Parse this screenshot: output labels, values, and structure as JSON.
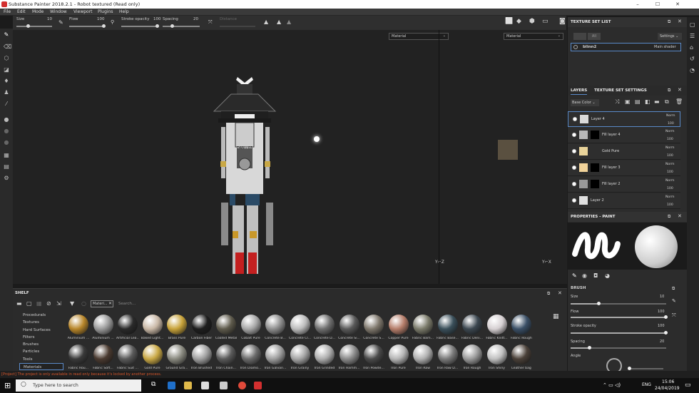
{
  "window": {
    "title": "Substance Painter 2018.2.1 - Robot textured (Read only)",
    "controls": [
      "–",
      "☐",
      "✕"
    ]
  },
  "menu": [
    "File",
    "Edit",
    "Mode",
    "Window",
    "Viewport",
    "Plugins",
    "Help"
  ],
  "toolbar": {
    "size_label": "Size",
    "size_value": "10",
    "flow_label": "Flow",
    "flow_value": "100",
    "stroke_label": "Stroke opacity",
    "stroke_value": "100",
    "spacing_label": "Spacing",
    "spacing_value": "20",
    "distance_label": "Distance"
  },
  "viewport": {
    "left_select": "Material",
    "right_select": "Material",
    "robot_label": "DAN - 03"
  },
  "shelf": {
    "title": "SHELF",
    "categories": [
      "Procedurals",
      "Textures",
      "Hard Surfaces",
      "Filters",
      "Brushes",
      "Particles",
      "Tools",
      "Materials"
    ],
    "selected_category": "Materials",
    "filter_tag": "Materi...",
    "search_placeholder": "Search...",
    "row1": [
      {
        "name": "Aluminium ...",
        "color": "#b8862a"
      },
      {
        "name": "Aluminium ...",
        "color": "#9a9a9a"
      },
      {
        "name": "Artificial Lea...",
        "color": "#2a2a2a"
      },
      {
        "name": "Baked Light...",
        "color": "#c9b8a6"
      },
      {
        "name": "Brass Pure",
        "color": "#c8a33a"
      },
      {
        "name": "Carbon Fiber",
        "color": "#1e1e1e"
      },
      {
        "name": "Coated Metal",
        "color": "#5e5a4c"
      },
      {
        "name": "Cobalt Pure",
        "color": "#a8a8a8"
      },
      {
        "name": "Concrete B...",
        "color": "#8e8e8e"
      },
      {
        "name": "Concrete Cl...",
        "color": "#bcbcbc"
      },
      {
        "name": "Concrete D...",
        "color": "#6e6e6e"
      },
      {
        "name": "Concrete Si...",
        "color": "#595959"
      },
      {
        "name": "Concrete S...",
        "color": "#7e776c"
      },
      {
        "name": "Copper Pure",
        "color": "#b57d6a"
      },
      {
        "name": "Fabric Bam...",
        "color": "#7a7a6a"
      },
      {
        "name": "Fabric Base...",
        "color": "#3a4f5a"
      },
      {
        "name": "Fabric Deni...",
        "color": "#3c4750"
      },
      {
        "name": "Fabric Knitt...",
        "color": "#d6d0d2"
      },
      {
        "name": "Fabric Rough",
        "color": "#3a4f66"
      }
    ],
    "row2": [
      {
        "name": "Fabric Rou...",
        "color": "#3a3a3a"
      },
      {
        "name": "Fabric Soft...",
        "color": "#4a3a30"
      },
      {
        "name": "Fabric Suit ...",
        "color": "#5a5a5a"
      },
      {
        "name": "Gold Pure",
        "color": "#c9a845"
      },
      {
        "name": "Ground Gra...",
        "color": "#8a8a80"
      },
      {
        "name": "Iron Brushed",
        "color": "#a0a0a0"
      },
      {
        "name": "Iron Chain...",
        "color": "#5a5a5a"
      },
      {
        "name": "Iron Diamo...",
        "color": "#6a6a6a"
      },
      {
        "name": "Iron Galvan...",
        "color": "#9e9e9e"
      },
      {
        "name": "Iron Grainy",
        "color": "#a5a5a5"
      },
      {
        "name": "Iron Grinded",
        "color": "#adadad"
      },
      {
        "name": "Iron Hamm...",
        "color": "#8a8a8a"
      },
      {
        "name": "Iron Powde...",
        "color": "#4a4a4a"
      },
      {
        "name": "Iron Pure",
        "color": "#b5b5b5"
      },
      {
        "name": "Iron Raw",
        "color": "#b0b0b0"
      },
      {
        "name": "Iron Raw D...",
        "color": "#7a7a7a"
      },
      {
        "name": "Iron Rough",
        "color": "#9a9a9a"
      },
      {
        "name": "Iron Shiny",
        "color": "#c0c0c0"
      },
      {
        "name": "Leather bag",
        "color": "#4a4038"
      }
    ]
  },
  "texture_set_list": {
    "title": "TEXTURE SET LIST",
    "btn1": "",
    "btn2": "All",
    "settings": "Settings",
    "item": "blinn2",
    "shader": "Main shader"
  },
  "layers_panel": {
    "tab_layers": "LAYERS",
    "tab_tss": "TEXTURE SET SETTINGS",
    "channel": "Base Color",
    "layers": [
      {
        "name": "Layer 4",
        "blend": "Norm",
        "opacity": "100",
        "thumb": "#d9d9d9"
      },
      {
        "name": "Fill layer 4",
        "blend": "Norm",
        "opacity": "100",
        "thumb": "#b8b8b8"
      },
      {
        "name": "Gold Pure",
        "blend": "Norm",
        "opacity": "100",
        "thumb": "#e9d39a"
      },
      {
        "name": "Fill layer 3",
        "blend": "Norm",
        "opacity": "100",
        "thumb": "#f1d39a"
      },
      {
        "name": "Fill layer 2",
        "blend": "Norm",
        "opacity": "100",
        "thumb": "#9a9a9a"
      },
      {
        "name": "Layer 2",
        "blend": "Norm",
        "opacity": "100",
        "thumb": "#e0e0e0"
      }
    ]
  },
  "properties": {
    "title": "PROPERTIES - PAINT",
    "brush_title": "BRUSH",
    "size_label": "Size",
    "size_value": "10",
    "size_fill": 0.3,
    "flow_label": "Flow",
    "flow_value": "100",
    "flow_fill": 1.0,
    "stroke_label": "Stroke opacity",
    "stroke_value": "100",
    "stroke_fill": 1.0,
    "spacing_label": "Spacing",
    "spacing_value": "20",
    "spacing_fill": 0.2,
    "angle_label": "Angle"
  },
  "status": {
    "message": "[Project] The project is only available in read only because it's locked by another process."
  },
  "taskbar": {
    "search": "Type here to search",
    "time": "15:06",
    "date": "24/04/2019",
    "lang": "ENG"
  }
}
